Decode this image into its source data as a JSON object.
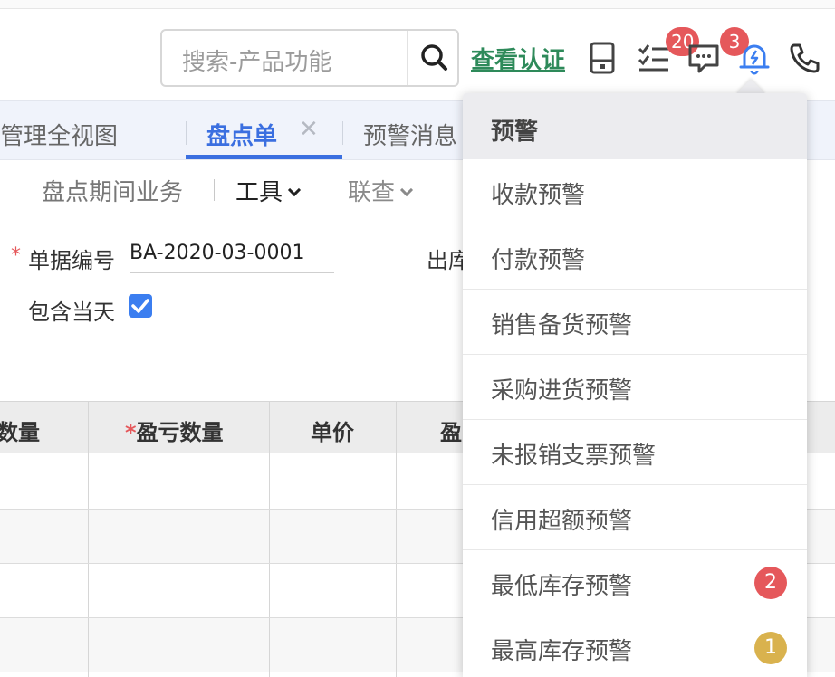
{
  "header": {
    "search_placeholder": "搜索-产品功能",
    "verify_link": "查看认证",
    "todo_badge": "20",
    "message_badge": "3"
  },
  "tabs": [
    {
      "label": "管理全视图"
    },
    {
      "label": "盘点单"
    },
    {
      "label": "预警消息"
    }
  ],
  "toolbar": {
    "period_business": "盘点期间业务",
    "tools": "工具",
    "lookup": "联查"
  },
  "form": {
    "doc_no_label": "单据编号",
    "doc_no_value": "BA-2020-03-0001",
    "outbound_label": "出库",
    "include_today_label": "包含当天",
    "include_today_checked": true
  },
  "table": {
    "columns": [
      "数量",
      "盈亏数量",
      "单价",
      "盈"
    ]
  },
  "dropdown": {
    "title": "预警",
    "items": [
      {
        "label": "收款预警",
        "badge": ""
      },
      {
        "label": "付款预警",
        "badge": ""
      },
      {
        "label": "销售备货预警",
        "badge": ""
      },
      {
        "label": "采购进货预警",
        "badge": ""
      },
      {
        "label": "未报销支票预警",
        "badge": ""
      },
      {
        "label": "信用超额预警",
        "badge": ""
      },
      {
        "label": "最低库存预警",
        "badge": "2"
      },
      {
        "label": "最高库存预警",
        "badge": "1"
      }
    ],
    "badge_colors": {
      "red": "#e5585b",
      "gold": "#d9b24e"
    }
  },
  "colors": {
    "accent": "#3b6fe0",
    "verify_green": "#2e8a5a",
    "badge_red": "#e5585b"
  }
}
